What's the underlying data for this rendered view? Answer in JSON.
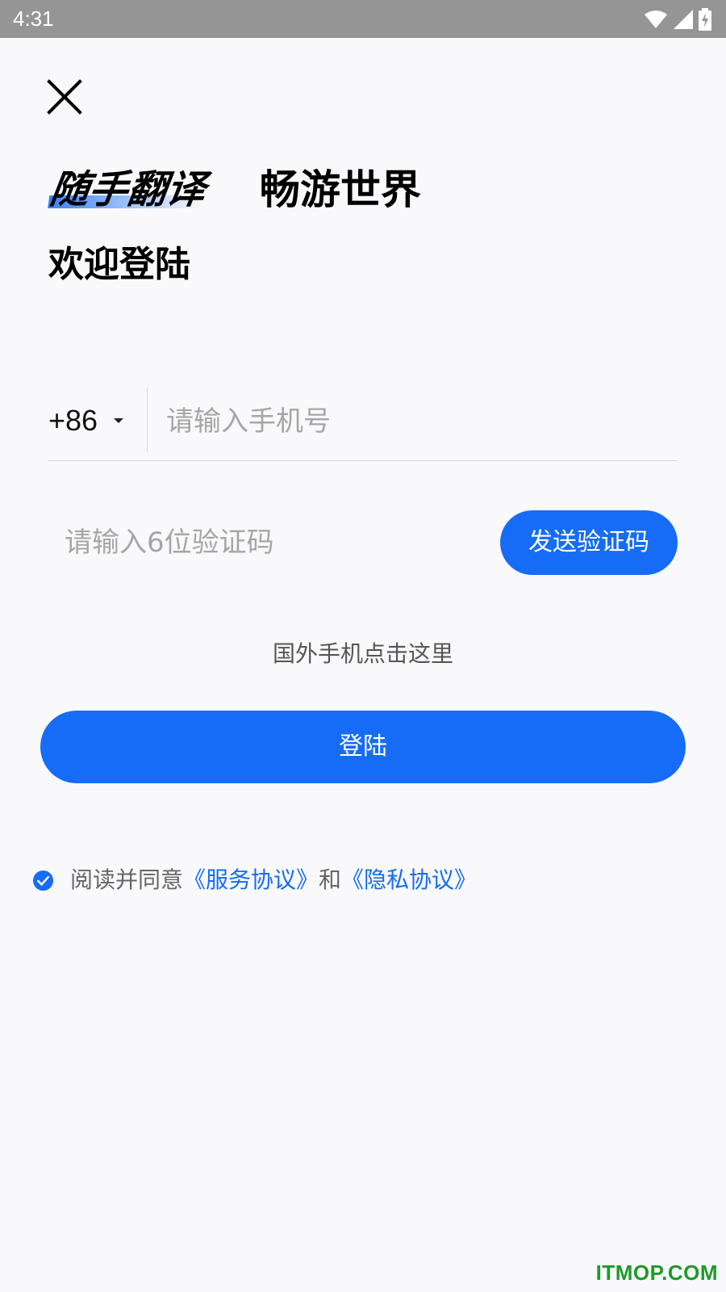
{
  "status_bar": {
    "time": "4:31",
    "icons": [
      "wifi-icon",
      "signal-icon",
      "battery-charging-icon"
    ]
  },
  "header": {
    "close_icon": "close-icon"
  },
  "headline": {
    "slogan_left": "随手翻译",
    "slogan_right": "畅游世界",
    "welcome": "欢迎登陆"
  },
  "phone": {
    "country_code": "+86",
    "placeholder": "请输入手机号",
    "value": ""
  },
  "verification": {
    "placeholder": "请输入6位验证码",
    "value": "",
    "send_button_label": "发送验证码"
  },
  "foreign_phone_link": "国外手机点击这里",
  "login_button_label": "登陆",
  "agreement": {
    "checked": true,
    "prefix": "阅读并同意",
    "service_link": "《服务协议》",
    "conjunction": "和",
    "privacy_link": "《隐私协议》"
  },
  "watermark": "ITMOP.COM",
  "colors": {
    "accent": "#166cf6",
    "status_bar": "#959595",
    "background": "#f9f9fb",
    "watermark": "#1e9a28"
  }
}
